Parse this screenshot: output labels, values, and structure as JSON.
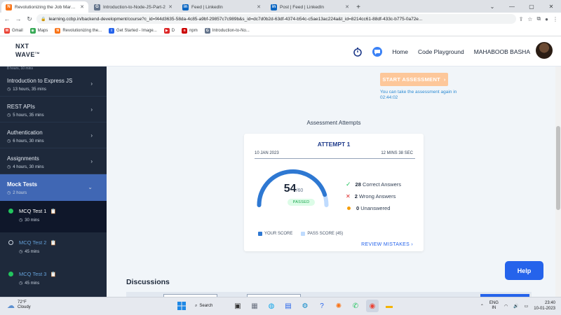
{
  "browser": {
    "tabs": [
      {
        "title": "Revolutionizing the Job Market | ",
        "icon_color": "#f97316",
        "icon_char": "N",
        "active": true
      },
      {
        "title": "Introduction-to-Node-JS-Part-2",
        "icon_color": "#64748b",
        "icon_char": "G",
        "active": false
      },
      {
        "title": "Feed | LinkedIn",
        "icon_color": "#0a66c2",
        "icon_char": "in",
        "active": false
      },
      {
        "title": "Post | Feed | LinkedIn",
        "icon_color": "#0a66c2",
        "icon_char": "in",
        "active": false
      }
    ],
    "url": "learning.ccbp.in/backend-development/course?c_id=f44d3635-58da-4c85-a9bf-29857c7c989b&s_id=dc7d0b2d-63df-4374-b54c-c5ae13ac224a&t_id=8214cc61-88df-433c-b775-0a72e...",
    "bookmarks": [
      {
        "label": "Gmail",
        "color": "#ea4335",
        "char": "M"
      },
      {
        "label": "Maps",
        "color": "#34a853",
        "char": "◉"
      },
      {
        "label": "Revolutionizing the...",
        "color": "#f97316",
        "char": "N"
      },
      {
        "label": "Get Started - Image...",
        "color": "#2563eb",
        "char": "i"
      },
      {
        "label": "D",
        "color": "#dc2626",
        "char": "▶"
      },
      {
        "label": "npm",
        "color": "#cb0000",
        "char": "n"
      },
      {
        "label": "Introduction-to-No...",
        "color": "#64748b",
        "char": "G"
      }
    ]
  },
  "header": {
    "logo_line1": "NXT",
    "logo_line2": "WAVE",
    "logo_tm": "TM",
    "nav": [
      "Home",
      "Code Playground"
    ],
    "user": "MAHABOOB BASHA"
  },
  "sidebar": {
    "top_partial": "8 hours, 10 mins",
    "items": [
      {
        "title": "Introduction to Express JS",
        "duration": "13 hours, 35 mins"
      },
      {
        "title": "REST APIs",
        "duration": "5 hours, 35 mins"
      },
      {
        "title": "Authentication",
        "duration": "6 hours, 30 mins"
      },
      {
        "title": "Assignments",
        "duration": "4 hours, 30 mins"
      }
    ],
    "active_item": {
      "title": "Mock Tests",
      "duration": "2 hours"
    },
    "subitems": [
      {
        "title": "MCQ Test 1",
        "duration": "30 mins",
        "status": "done"
      },
      {
        "title": "MCQ Test 2",
        "duration": "45 mins",
        "status": "open"
      },
      {
        "title": "MCQ Test 3",
        "duration": "45 mins",
        "status": "done"
      }
    ]
  },
  "main": {
    "start_button": "START ASSESSMENT",
    "retake_note": "You can take the assessment again in 02:44:02",
    "attempts_title": "Assessment Attempts",
    "attempt": {
      "label": "ATTEMPT 1",
      "date": "10 JAN 2023",
      "duration": "12 MINS 38 SEC",
      "score": "54",
      "out_of": "/60",
      "score_value": 54,
      "max_value": 60,
      "pass_value": 45,
      "status": "PASSED",
      "correct_count": "28",
      "correct_label": "Correct Answers",
      "wrong_count": "2",
      "wrong_label": "Wrong Answers",
      "unanswered_count": "0",
      "unanswered_label": "Unanswered",
      "legend_score": "YOUR SCORE",
      "legend_pass": "PASS SCORE (45)",
      "review": "REVIEW MISTAKES"
    },
    "discussions": "Discussions",
    "help": "Help"
  },
  "colors": {
    "accent": "#2563eb",
    "sidebar_bg": "#1e293b",
    "active_bg": "#4067b4",
    "gauge_score": "#2e78d2",
    "gauge_pass": "#bfdbfe",
    "success": "#22c55e",
    "warning": "#f59e0b",
    "danger": "#dc2626"
  },
  "taskbar": {
    "temp": "72°F",
    "weather": "Cloudy",
    "search": "Search",
    "lang1": "ENG",
    "lang2": "IN",
    "time": "23:40",
    "date": "10-01-2023"
  }
}
